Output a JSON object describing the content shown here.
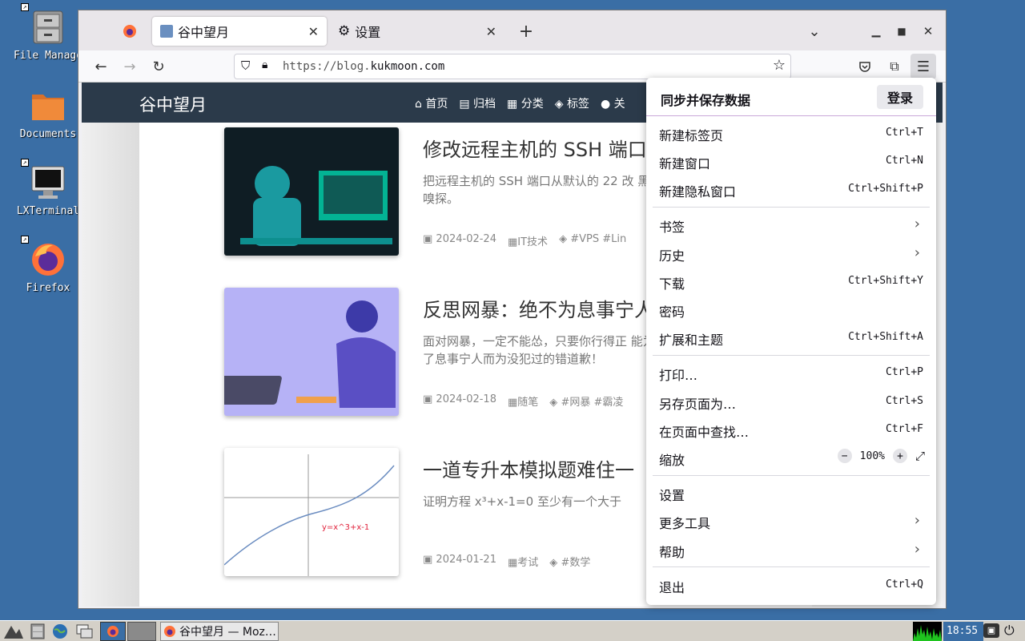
{
  "desktop": {
    "icons": [
      {
        "label": "File Manage"
      },
      {
        "label": "Documents"
      },
      {
        "label": "LXTerminal"
      },
      {
        "label": "Firefox"
      }
    ]
  },
  "browser": {
    "tabs": [
      {
        "label": "谷中望月"
      },
      {
        "label": "设置"
      }
    ],
    "url_prefix": "https://blog.",
    "url_domain": "kukmoon.com"
  },
  "site": {
    "title": "谷中望月",
    "nav": [
      {
        "label": "首页"
      },
      {
        "label": "归档"
      },
      {
        "label": "分类"
      },
      {
        "label": "标签"
      },
      {
        "label": "关"
      }
    ],
    "posts": [
      {
        "title": "修改远程主机的 SSH 端口",
        "desc": "把远程主机的 SSH 端口从默认的 22 改 黑客嗅探。",
        "date": "2024-02-24",
        "category": "IT技术",
        "tags": "#VPS #Lin"
      },
      {
        "title": "反思网暴：绝不为息事宁人",
        "desc": "面对网暴，一定不能怂，只要你行得正 能为了息事宁人而为没犯过的错道歉！",
        "date": "2024-02-18",
        "category": "随笔",
        "tags": "#网暴 #霸凌"
      },
      {
        "title": "一道专升本模拟题难住一",
        "desc": "证明方程 x³+x-1=0 至少有一个大于",
        "date": "2024-01-21",
        "category": "考试",
        "tags": "#数学"
      }
    ],
    "graph_label": "y=x^3+x-1"
  },
  "menu": {
    "header": "同步并保存数据",
    "login": "登录",
    "items": [
      {
        "label": "新建标签页",
        "shortcut": "Ctrl+T"
      },
      {
        "label": "新建窗口",
        "shortcut": "Ctrl+N"
      },
      {
        "label": "新建隐私窗口",
        "shortcut": "Ctrl+Shift+P"
      },
      {
        "label": "书签",
        "shortcut": ""
      },
      {
        "label": "历史",
        "shortcut": ""
      },
      {
        "label": "下载",
        "shortcut": "Ctrl+Shift+Y"
      },
      {
        "label": "密码",
        "shortcut": ""
      },
      {
        "label": "扩展和主题",
        "shortcut": "Ctrl+Shift+A"
      },
      {
        "label": "打印…",
        "shortcut": "Ctrl+P"
      },
      {
        "label": "另存页面为…",
        "shortcut": "Ctrl+S"
      },
      {
        "label": "在页面中查找…",
        "shortcut": "Ctrl+F"
      },
      {
        "label": "缩放",
        "shortcut": ""
      },
      {
        "label": "设置",
        "shortcut": ""
      },
      {
        "label": "更多工具",
        "shortcut": ""
      },
      {
        "label": "帮助",
        "shortcut": ""
      },
      {
        "label": "退出",
        "shortcut": "Ctrl+Q"
      }
    ],
    "zoom": "100%"
  },
  "taskbar": {
    "task_label": "谷中望月 — Moz…",
    "clock": "18:55"
  }
}
